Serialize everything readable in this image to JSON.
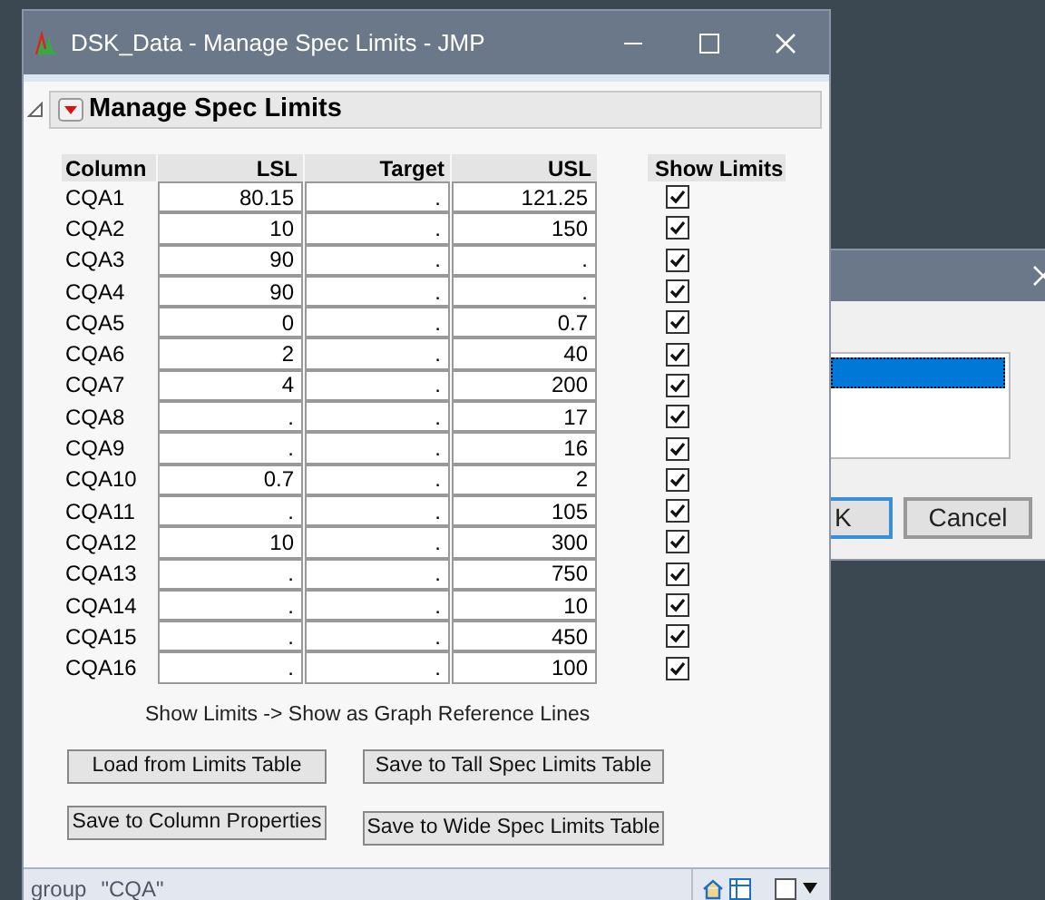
{
  "back_dialog": {
    "list_items": [
      {
        "selected": true
      }
    ],
    "buttons": [
      {
        "label": "K",
        "focused": true
      },
      {
        "label": "Cancel",
        "focused": false
      }
    ]
  },
  "window": {
    "title": "DSK_Data - Manage Spec Limits - JMP"
  },
  "outline": {
    "title": "Manage Spec Limits",
    "expanded": true
  },
  "table": {
    "columns": [
      "Column",
      "LSL",
      "Target",
      "USL",
      "Show Limits"
    ],
    "rows": [
      {
        "column": "CQA1",
        "lsl": "80.15",
        "target": ".",
        "usl": "121.25",
        "show": true
      },
      {
        "column": "CQA2",
        "lsl": "10",
        "target": ".",
        "usl": "150",
        "show": true
      },
      {
        "column": "CQA3",
        "lsl": "90",
        "target": ".",
        "usl": ".",
        "show": true
      },
      {
        "column": "CQA4",
        "lsl": "90",
        "target": ".",
        "usl": ".",
        "show": true
      },
      {
        "column": "CQA5",
        "lsl": "0",
        "target": ".",
        "usl": "0.7",
        "show": true
      },
      {
        "column": "CQA6",
        "lsl": "2",
        "target": ".",
        "usl": "40",
        "show": true
      },
      {
        "column": "CQA7",
        "lsl": "4",
        "target": ".",
        "usl": "200",
        "show": true
      },
      {
        "column": "CQA8",
        "lsl": ".",
        "target": ".",
        "usl": "17",
        "show": true
      },
      {
        "column": "CQA9",
        "lsl": ".",
        "target": ".",
        "usl": "16",
        "show": true
      },
      {
        "column": "CQA10",
        "lsl": "0.7",
        "target": ".",
        "usl": "2",
        "show": true
      },
      {
        "column": "CQA11",
        "lsl": ".",
        "target": ".",
        "usl": "105",
        "show": true
      },
      {
        "column": "CQA12",
        "lsl": "10",
        "target": ".",
        "usl": "300",
        "show": true
      },
      {
        "column": "CQA13",
        "lsl": ".",
        "target": ".",
        "usl": "750",
        "show": true
      },
      {
        "column": "CQA14",
        "lsl": ".",
        "target": ".",
        "usl": "10",
        "show": true
      },
      {
        "column": "CQA15",
        "lsl": ".",
        "target": ".",
        "usl": "450",
        "show": true
      },
      {
        "column": "CQA16",
        "lsl": ".",
        "target": ".",
        "usl": "100",
        "show": true
      }
    ]
  },
  "note": "Show Limits -> Show as Graph Reference Lines",
  "buttons": [
    "Load from Limits Table",
    "Save to Tall Spec Limits Table",
    "Save to Column Properties",
    "Save to Wide Spec Limits Table"
  ],
  "status_bar": {
    "label": "group",
    "value": "\"CQA\""
  }
}
